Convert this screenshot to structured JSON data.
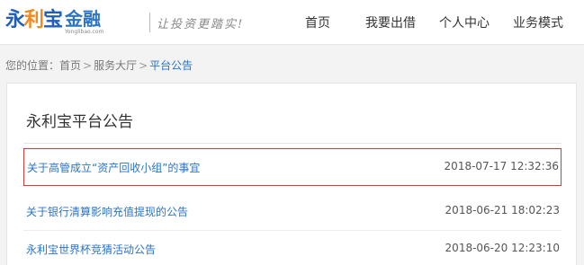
{
  "brand": {
    "logo_part1": "永",
    "logo_part2": "利",
    "logo_part3": "宝",
    "logo_jr": "金融",
    "logo_url": "Yonglibao.com",
    "slogan": "让投资更踏实!"
  },
  "nav": {
    "items": [
      "首页",
      "我要出借",
      "个人中心",
      "业务模式"
    ]
  },
  "breadcrumb": {
    "prefix": "您的位置：",
    "home": "首页",
    "hall": "服务大厅",
    "current": "平台公告",
    "separator": ">"
  },
  "panel": {
    "title": "永利宝平台公告",
    "announcements": [
      {
        "title": "关于高管成立“资产回收小组”的事宜",
        "date": "2018-07-17 12:32:36"
      },
      {
        "title": "关于银行清算影响充值提现的公告",
        "date": "2018-06-21 18:02:23"
      },
      {
        "title": "永利宝世界杯竞猜活动公告",
        "date": "2018-06-20 12:23:10"
      }
    ]
  },
  "colors": {
    "link": "#2b74c7",
    "highlight_border": "#d23b3b",
    "brand_blue": "#1f5fb8",
    "brand_orange": "#f08a1c"
  }
}
